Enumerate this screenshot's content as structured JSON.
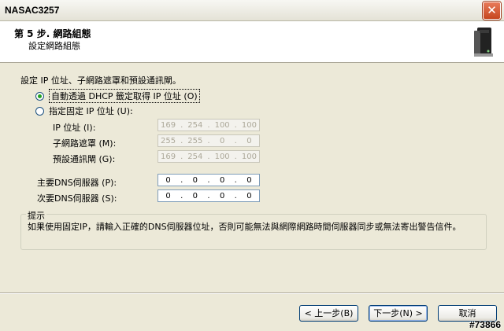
{
  "window": {
    "title": "NASAC3257"
  },
  "header": {
    "step_title": "第 5 步. 網路組態",
    "step_subtitle": "設定網路組態",
    "icon": "nas-device-icon"
  },
  "main": {
    "section_label": "設定 IP 位址、子網路遮罩和預設通訊閘。",
    "radio_dhcp": {
      "label": "自動透過 DHCP 籤定取得 IP 位址 (O)",
      "checked": true
    },
    "radio_static": {
      "label": "指定固定 IP 位址 (U):",
      "checked": false
    },
    "ip_label": "IP 位址 (I):",
    "ip_octets": [
      "169",
      "254",
      "100",
      "100"
    ],
    "mask_label": "子網路遮罩 (M):",
    "mask_octets": [
      "255",
      "255",
      "0",
      "0"
    ],
    "gw_label": "預設通訊閘 (G):",
    "gw_octets": [
      "169",
      "254",
      "100",
      "100"
    ],
    "dns1_label": "主要DNS伺服器 (P):",
    "dns1_octets": [
      "0",
      "0",
      "0",
      "0"
    ],
    "dns2_label": "次要DNS伺服器 (S):",
    "dns2_octets": [
      "0",
      "0",
      "0",
      "0"
    ]
  },
  "tip": {
    "legend": "提示",
    "text": "如果使用固定IP，請輸入正確的DNS伺服器位址，否則可能無法與網際網路時間伺服器同步或無法寄出警告信件。"
  },
  "footer": {
    "back_label": "< 上一步(B)",
    "next_label": "下一步(N) >",
    "cancel_label": "取消"
  },
  "watermark": "#73866",
  "colors": {
    "accent": "#21a121",
    "close": "#c6461f"
  }
}
